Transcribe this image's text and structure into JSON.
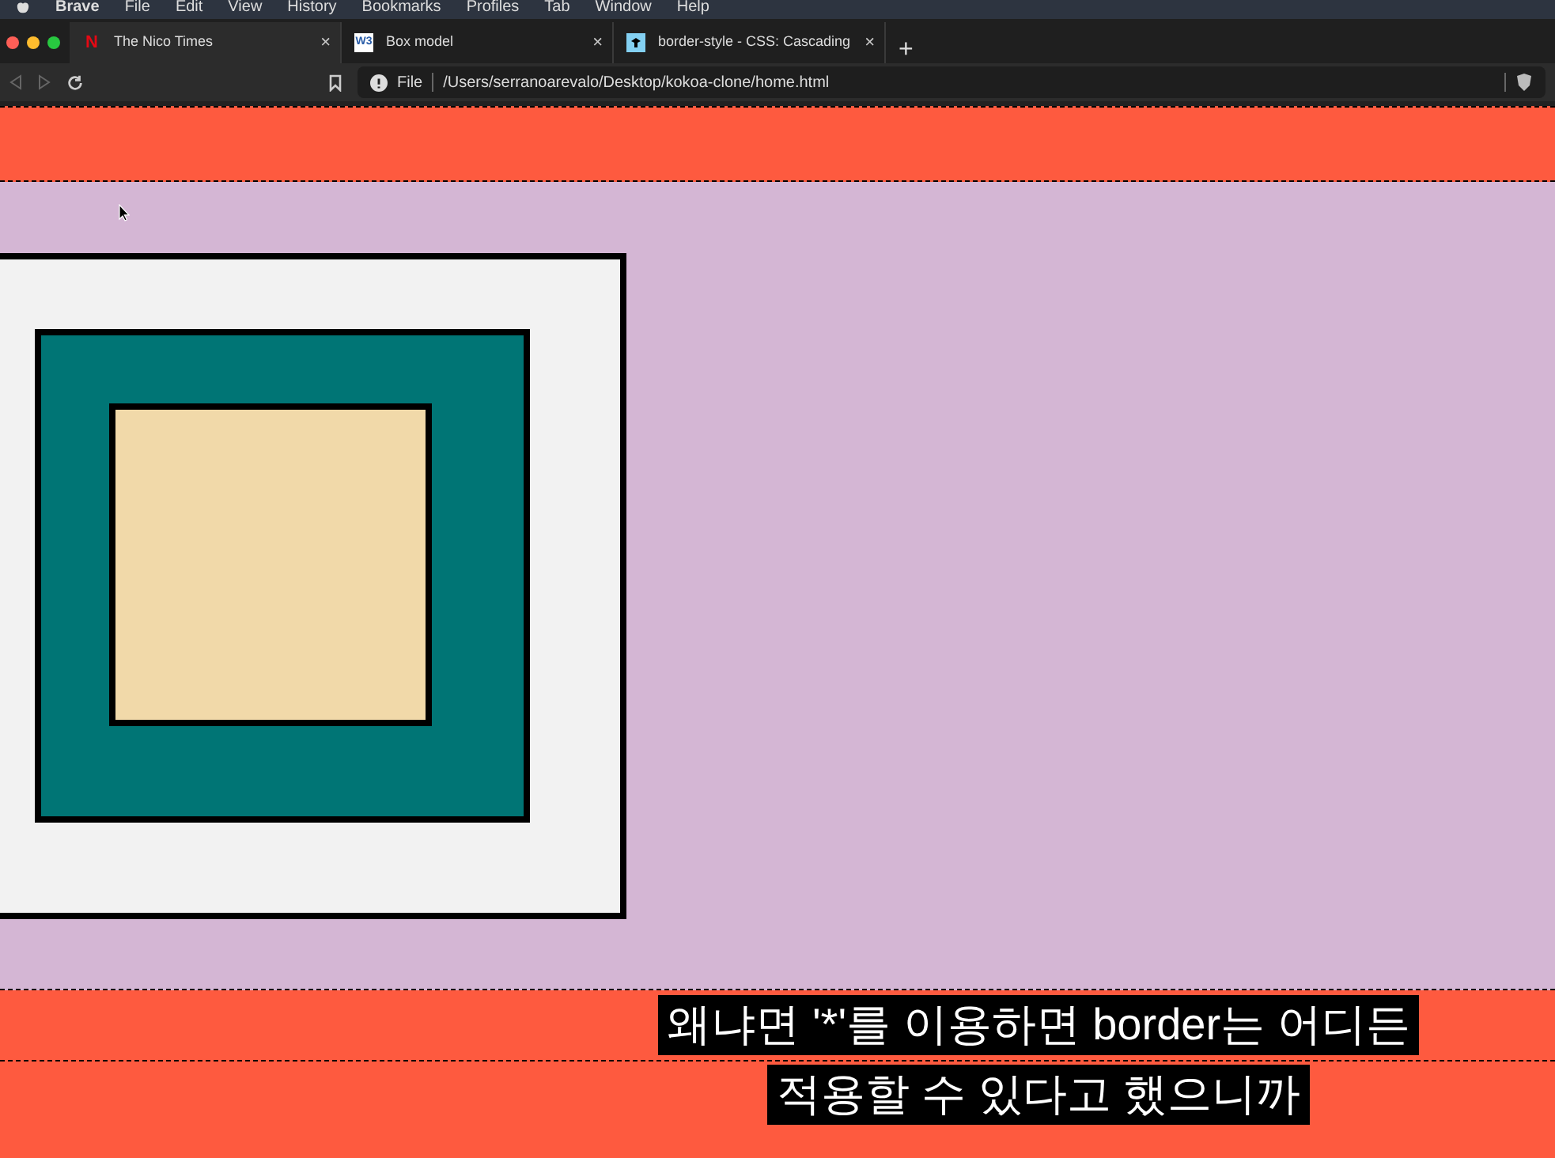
{
  "menu_bar": {
    "app": "Brave",
    "items": [
      "File",
      "Edit",
      "View",
      "History",
      "Bookmarks",
      "Profiles",
      "Tab",
      "Window",
      "Help"
    ]
  },
  "tabs": [
    {
      "title": "The Nico Times",
      "selected": true,
      "icon": "N",
      "close": "×"
    },
    {
      "title": "Box model",
      "selected": false,
      "icon": "W3",
      "close": "×"
    },
    {
      "title": "border-style - CSS: Cascading",
      "selected": false,
      "close": "×"
    }
  ],
  "new_tab": "+",
  "toolbar": {
    "scheme": "File",
    "url": "/Users/serranoarevalo/Desktop/kokoa-clone/home.html"
  },
  "subtitles": [
    "왜냐면 '*'를 이용하면 border는 어디든",
    "적용할 수 있다고 했으니까"
  ]
}
